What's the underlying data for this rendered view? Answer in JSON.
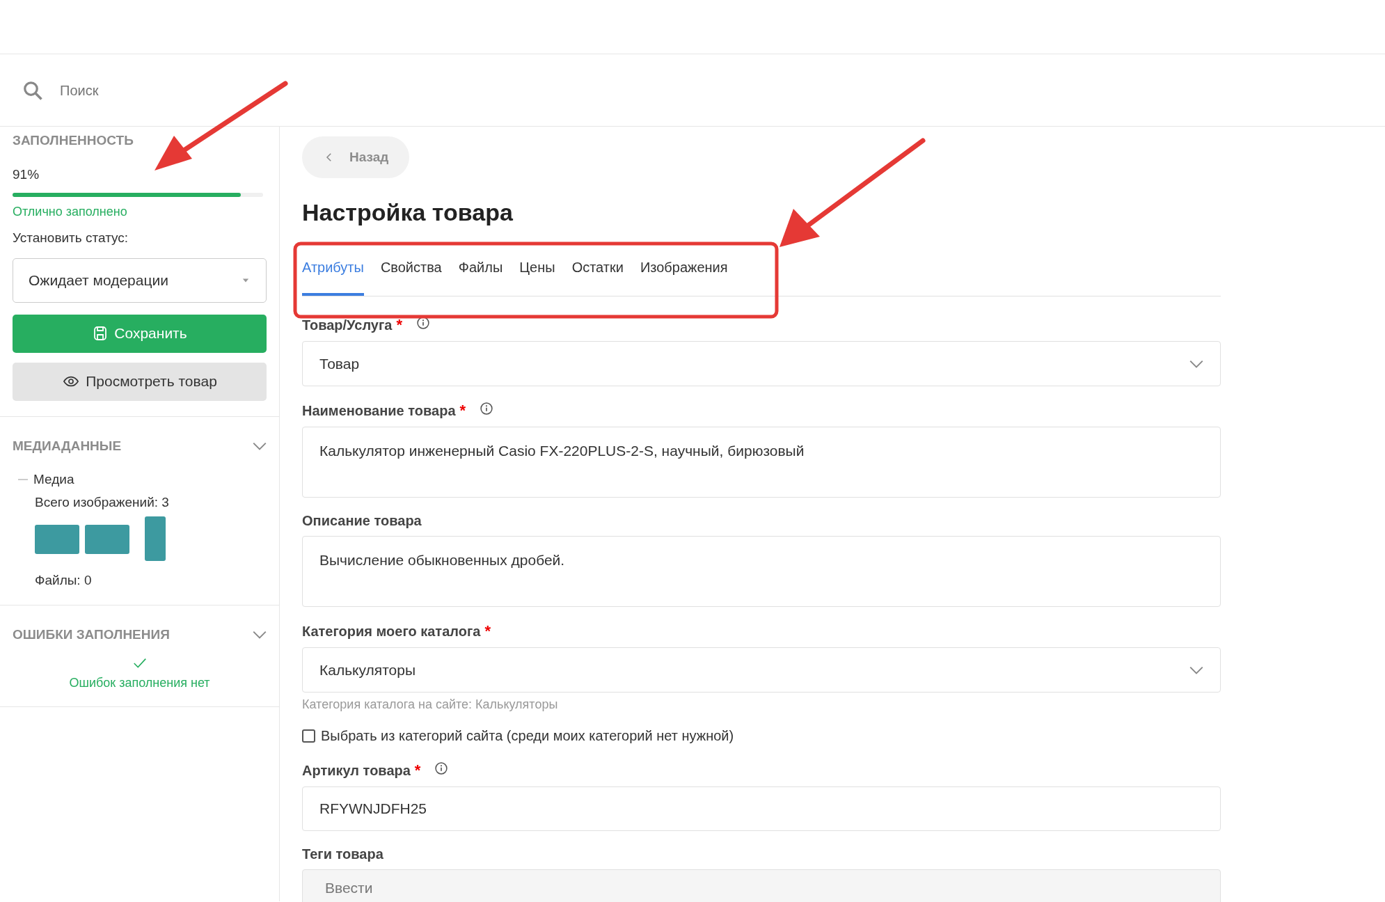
{
  "search": {
    "placeholder": "Поиск"
  },
  "sidebar": {
    "completeness": {
      "heading": "ЗАПОЛНЕННОСТЬ",
      "percent": "91%",
      "level": 0.91,
      "verdict": "Отлично заполнено"
    },
    "status": {
      "label": "Установить статус:",
      "value": "Ожидает модерации"
    },
    "save_button": "Сохранить",
    "view_button": "Просмотреть товар",
    "media": {
      "heading": "МЕДИАДАННЫЕ",
      "expanded": true,
      "group": "Медиа",
      "images_total": "Всего изображений: 3",
      "images": [
        {
          "kind": "wide"
        },
        {
          "kind": "wide"
        },
        {
          "kind": "tall"
        }
      ],
      "files": "Файлы: 0"
    },
    "errors": {
      "heading": "ОШИБКИ ЗАПОЛНЕНИЯ",
      "expanded": true,
      "message": "Ошибок заполнения нет"
    }
  },
  "main": {
    "back_button": "Назад",
    "title": "Настройка товара",
    "tabs": [
      {
        "label": "Атрибуты",
        "selected": true
      },
      {
        "label": "Свойства",
        "selected": false
      },
      {
        "label": "Файлы",
        "selected": false
      },
      {
        "label": "Цены",
        "selected": false
      },
      {
        "label": "Остатки",
        "selected": false
      },
      {
        "label": "Изображения",
        "selected": false
      }
    ],
    "fields": [
      {
        "kind": "select",
        "label": "Товар/Услуга",
        "required_mark": "*",
        "info": true,
        "value": "Товар"
      },
      {
        "kind": "textarea",
        "label": "Наименование товара",
        "required_mark": "*",
        "info": true,
        "value": "Калькулятор инженерный Casio FX-220PLUS-2-S, научный, бирюзовый"
      },
      {
        "kind": "textarea",
        "label": "Описание товара",
        "value": "Вычисление обыкновенных дробей."
      },
      {
        "kind": "select",
        "label": "Категория моего каталога",
        "required_mark": "*",
        "value": "Калькуляторы",
        "hint": "Категория каталога на сайте: Калькуляторы"
      },
      {
        "kind": "checkbox",
        "label": "Выбрать из категорий сайта (среди моих категорий нет нужной)",
        "checked": false
      },
      {
        "kind": "input",
        "label": "Артикул товара",
        "required_mark": "*",
        "info": true,
        "value": "RFYWNJDFH25"
      },
      {
        "kind": "tags",
        "label": "Теги товара",
        "placeholder": "Ввести"
      }
    ]
  }
}
